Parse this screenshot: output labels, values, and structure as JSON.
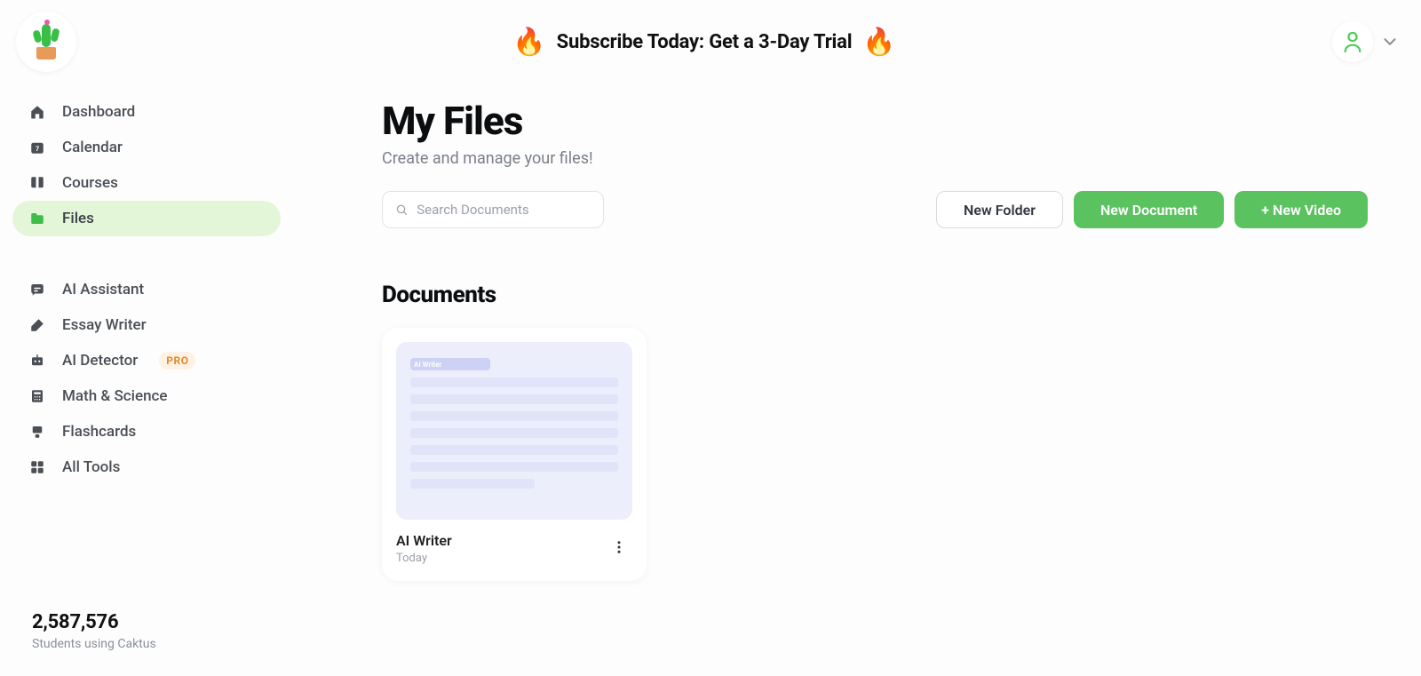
{
  "header": {
    "banner_text": "Subscribe Today: Get a 3-Day Trial"
  },
  "sidebar": {
    "items": [
      {
        "label": "Dashboard"
      },
      {
        "label": "Calendar"
      },
      {
        "label": "Courses"
      },
      {
        "label": "Files"
      },
      {
        "label": "AI Assistant"
      },
      {
        "label": "Essay Writer"
      },
      {
        "label": "AI Detector",
        "badge": "PRO"
      },
      {
        "label": "Math & Science"
      },
      {
        "label": "Flashcards"
      },
      {
        "label": "All Tools"
      }
    ],
    "footer": {
      "count": "2,587,576",
      "label": "Students using Caktus"
    }
  },
  "page": {
    "title": "My Files",
    "subtitle": "Create and manage your files!",
    "search_placeholder": "Search Documents",
    "buttons": {
      "new_folder": "New Folder",
      "new_document": "New Document",
      "new_video": "+ New Video"
    },
    "section_title": "Documents",
    "documents": [
      {
        "preview_tag": "AI Writer",
        "title": "AI Writer",
        "date": "Today"
      }
    ]
  }
}
